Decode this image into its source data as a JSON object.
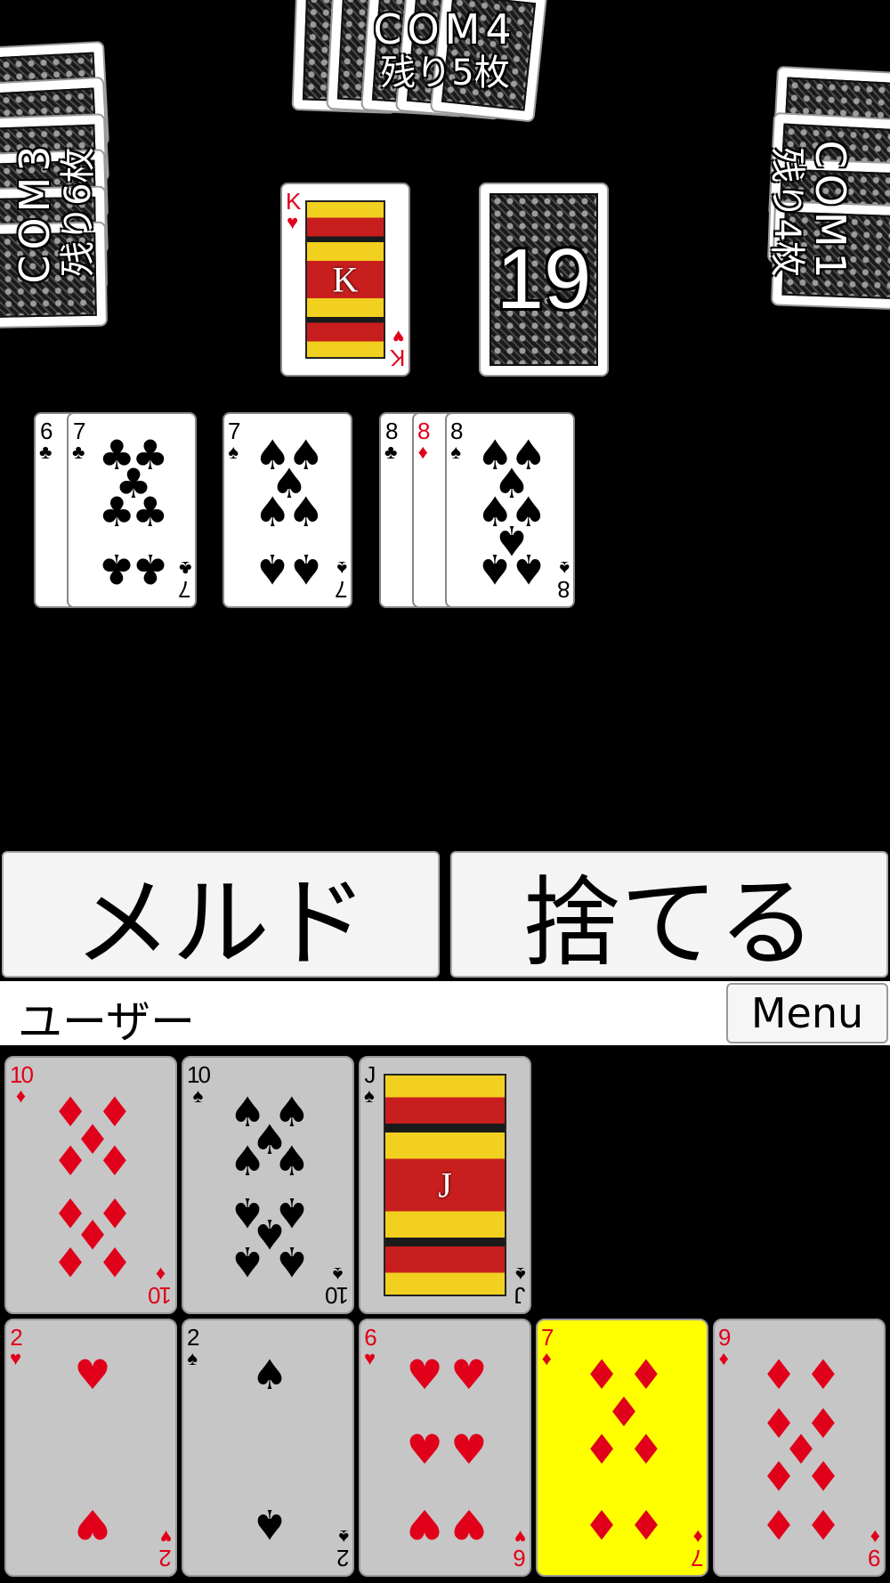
{
  "opponents": {
    "com4": {
      "name": "COM4",
      "remaining": "残り5枚"
    },
    "com3": {
      "name": "COM3",
      "remaining": "残り6枚"
    },
    "com1": {
      "name": "COM1",
      "remaining": "残り4枚"
    }
  },
  "discard_top": {
    "rank": "K",
    "suit": "♥"
  },
  "deck": {
    "count": "19"
  },
  "melds": [
    [
      {
        "rank": "6",
        "suit": "♣"
      },
      {
        "rank": "7",
        "suit": "♣"
      }
    ],
    [
      {
        "rank": "7",
        "suit": "♠"
      }
    ],
    [
      {
        "rank": "8",
        "suit": "♣"
      },
      {
        "rank": "8",
        "suit": "♦"
      },
      {
        "rank": "8",
        "suit": "♠"
      }
    ]
  ],
  "actions": {
    "meld_label": "メルド",
    "discard_label": "捨てる"
  },
  "player": {
    "name": "ユーザー",
    "menu_label": "Menu"
  },
  "hand": {
    "row1": [
      {
        "rank": "10",
        "suit": "♦"
      },
      {
        "rank": "10",
        "suit": "♠"
      },
      {
        "rank": "J",
        "suit": "♠"
      }
    ],
    "row2": [
      {
        "rank": "2",
        "suit": "♥"
      },
      {
        "rank": "2",
        "suit": "♠"
      },
      {
        "rank": "6",
        "suit": "♥"
      },
      {
        "rank": "7",
        "suit": "♦",
        "selected": true
      },
      {
        "rank": "9",
        "suit": "♦"
      }
    ]
  },
  "colors": {
    "table": "#000000",
    "selected_card": "#ffff00",
    "red_suit": "#e0001a",
    "hand_card": "#c6c6c6"
  }
}
